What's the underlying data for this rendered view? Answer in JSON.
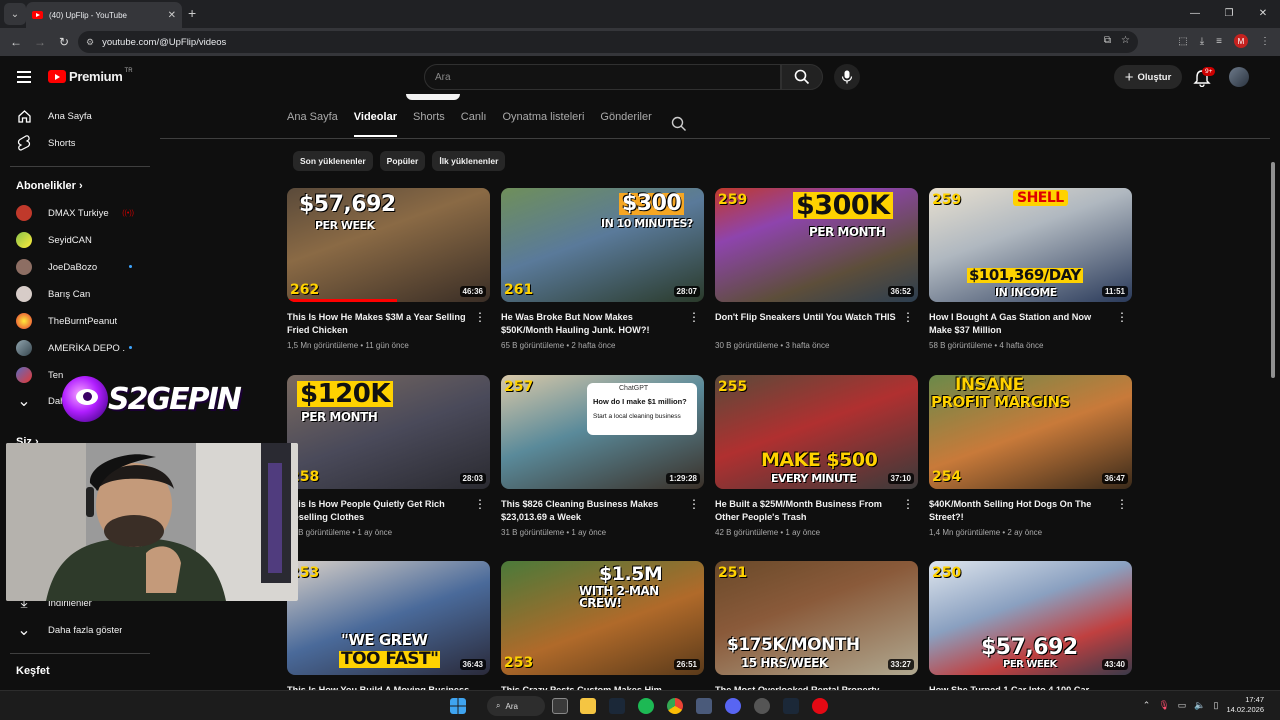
{
  "browser": {
    "tab_title": "(40) UpFlip - YouTube",
    "url": "youtube.com/@UpFlip/videos"
  },
  "header": {
    "logo_text": "Premium",
    "region": "TR",
    "search_placeholder": "Ara",
    "create_label": "Oluştur",
    "notification_count": "9+"
  },
  "sidebar": {
    "home": "Ana Sayfa",
    "shorts": "Shorts",
    "subscriptions_heading": "Abonelikler",
    "subscriptions": [
      "DMAX Turkiye",
      "SeyidCAN",
      "JoeDaBozo",
      "Barış Can",
      "TheBurntPeanut",
      "AMERİKA DEPO ...",
      "Ten",
      "Dah"
    ],
    "you_heading": "Siz",
    "downloads": "İndirilenler",
    "show_more": "Daha fazla göster",
    "explore_heading": "Keşfet"
  },
  "channel_tabs": [
    "Ana Sayfa",
    "Videolar",
    "Shorts",
    "Canlı",
    "Oynatma listeleri",
    "Gönderiler"
  ],
  "chips": [
    "Son yüklenenler",
    "Popüler",
    "İlk yüklenenler"
  ],
  "videos": [
    {
      "title": "This Is How He Makes $3M a Year Selling Fried Chicken",
      "meta": "1,5 Mn görüntüleme • 11 gün önce",
      "duration": "46:36",
      "number": "262",
      "headline": "$57,692",
      "sub": "PER WEEK"
    },
    {
      "title": "He Was Broke But Now Makes $50K/Month Hauling Junk. HOW?!",
      "meta": "65 B görüntüleme • 2 hafta önce",
      "duration": "28:07",
      "number": "261",
      "headline": "$300",
      "sub": "IN 10 MINUTES?"
    },
    {
      "title": "Don't Flip Sneakers Until You Watch THIS",
      "meta": "30 B görüntüleme • 3 hafta önce",
      "duration": "36:52",
      "number": "259",
      "headline": "$300K",
      "sub": "PER MONTH"
    },
    {
      "title": "How I Bought A Gas Station and Now Make $37 Million",
      "meta": "58 B görüntüleme • 4 hafta önce",
      "duration": "11:51",
      "number": "259",
      "headline": "$101,369/DAY",
      "sub": "IN INCOME",
      "extra": "SHELL"
    },
    {
      "title": "This Is How People Quietly Get Rich Reselling Clothes",
      "meta": "27 B görüntüleme • 1 ay önce",
      "duration": "28:03",
      "number": "258",
      "headline": "$120K",
      "sub": "PER MONTH"
    },
    {
      "title": "This $826 Cleaning Business Makes $23,013.69 a Week",
      "meta": "31 B görüntüleme • 1 ay önce",
      "duration": "1:29:28",
      "number": "257",
      "headline": "How do I make $1 million?",
      "sub": "Start a local cleaning business",
      "extra": "ChatGPT"
    },
    {
      "title": "He Built a $25M/Month Business From Other People's Trash",
      "meta": "42 B görüntüleme • 1 ay önce",
      "duration": "37:10",
      "number": "255",
      "headline": "MAKE $500",
      "sub": "EVERY MINUTE"
    },
    {
      "title": "$40K/Month Selling Hot Dogs On The Street?!",
      "meta": "1,4 Mn görüntüleme • 2 ay önce",
      "duration": "36:47",
      "number": "254",
      "headline": "INSANE",
      "sub": "PROFIT MARGINS"
    },
    {
      "title": "This Is How You Build A Moving Business",
      "meta": "",
      "duration": "36:43",
      "number": "253",
      "headline": "\"WE GREW",
      "sub": "TOO FAST\""
    },
    {
      "title": "This Crazy Pests Custom Makes Him",
      "meta": "",
      "duration": "26:51",
      "number": "253",
      "headline": "$1.5M",
      "sub": "WITH 2-MAN CREW!"
    },
    {
      "title": "The Most Overlooked Rental Property",
      "meta": "",
      "duration": "33:27",
      "number": "251",
      "headline": "$175K/MONTH",
      "sub": "15 HRS/WEEK"
    },
    {
      "title": "How She Turned 1 Car Into 4,100 Car",
      "meta": "",
      "duration": "43:40",
      "number": "250",
      "headline": "$57,692",
      "sub": "PER WEEK"
    }
  ],
  "overlay": {
    "logo_text": "S2GEPIN"
  },
  "taskbar": {
    "search_label": "Ara",
    "time": "17:47",
    "date": "14.02.2026"
  },
  "colors": {
    "accent": "#ff0000",
    "background": "#0f0f0f",
    "link_blue": "#3ea6ff"
  }
}
